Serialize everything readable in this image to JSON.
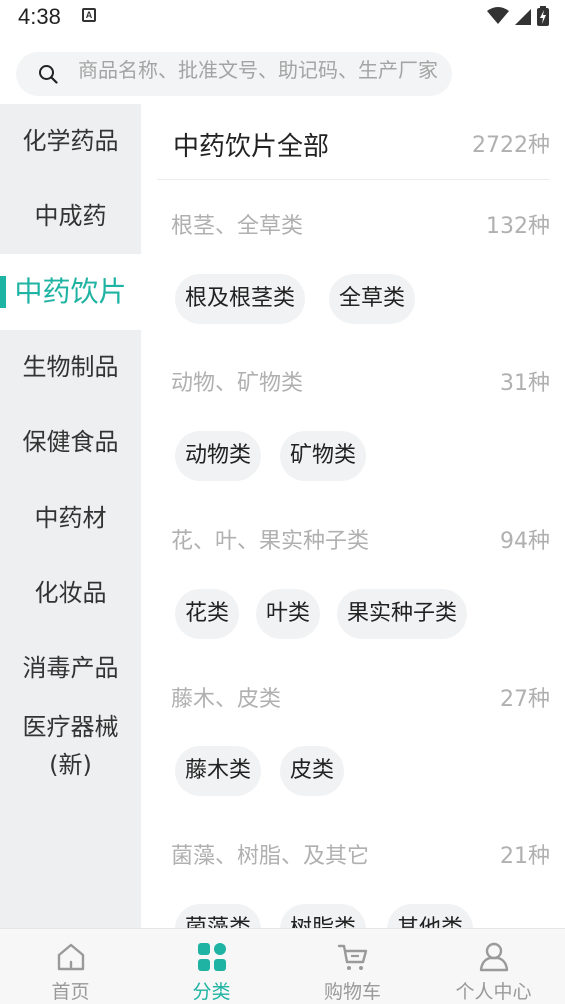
{
  "status_bar": {
    "time": "4:38",
    "notification_badge": "A"
  },
  "search": {
    "placeholder": "商品名称、批准文号、助记码、生产厂家"
  },
  "sidebar": {
    "items": [
      {
        "label": "化学药品"
      },
      {
        "label": "中成药"
      },
      {
        "label": "中药饮片",
        "active": true
      },
      {
        "label": "生物制品"
      },
      {
        "label": "保健食品"
      },
      {
        "label": "中药材"
      },
      {
        "label": "化妆品"
      },
      {
        "label": "消毒产品"
      },
      {
        "label": "医疗器械(新)"
      }
    ]
  },
  "content": {
    "all_title": "中药饮片全部",
    "all_count": "2722种",
    "groups": [
      {
        "title": "根茎、全草类",
        "count": "132种",
        "chips": [
          "根及根茎类",
          "全草类"
        ]
      },
      {
        "title": "动物、矿物类",
        "count": "31种",
        "chips": [
          "动物类",
          "矿物类"
        ]
      },
      {
        "title": "花、叶、果实种子类",
        "count": "94种",
        "chips": [
          "花类",
          "叶类",
          "果实种子类"
        ]
      },
      {
        "title": "藤木、皮类",
        "count": "27种",
        "chips": [
          "藤木类",
          "皮类"
        ]
      },
      {
        "title": "菌藻、树脂、及其它",
        "count": "21种",
        "chips": [
          "菌藻类",
          "树脂类",
          "其他类"
        ]
      }
    ]
  },
  "bottom_nav": {
    "items": [
      {
        "label": "首页",
        "icon": "home-icon"
      },
      {
        "label": "分类",
        "icon": "category-grid-icon",
        "active": true
      },
      {
        "label": "购物车",
        "icon": "cart-icon"
      },
      {
        "label": "个人中心",
        "icon": "profile-icon"
      }
    ]
  },
  "colors": {
    "accent": "#1fb3a3",
    "sidebar_bg": "#eeeff0",
    "chip_bg": "#f1f2f3",
    "muted_text": "#b0b0b0"
  }
}
